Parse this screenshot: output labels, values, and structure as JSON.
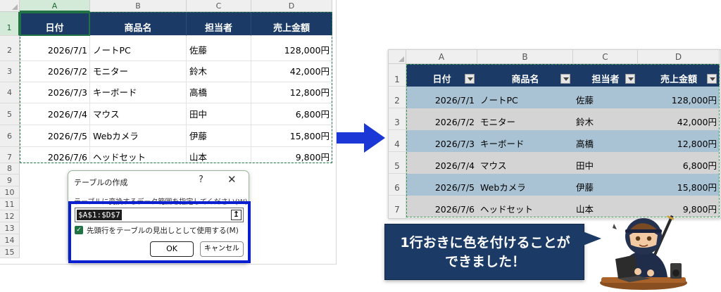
{
  "left_sheet": {
    "columns": [
      "A",
      "B",
      "C",
      "D"
    ],
    "rows": [
      "1",
      "2",
      "3",
      "4",
      "5",
      "6",
      "7",
      "8",
      "9",
      "10",
      "11",
      "12",
      "13",
      "14",
      "15"
    ],
    "header": [
      "日付",
      "商品名",
      "担当者",
      "売上金額"
    ],
    "data": [
      [
        "2026/7/1",
        "ノートPC",
        "佐藤",
        "128,000円"
      ],
      [
        "2026/7/2",
        "モニター",
        "鈴木",
        "42,000円"
      ],
      [
        "2026/7/3",
        "キーボード",
        "高橋",
        "12,800円"
      ],
      [
        "2026/7/4",
        "マウス",
        "田中",
        "6,800円"
      ],
      [
        "2026/7/5",
        "Webカメラ",
        "伊藤",
        "15,800円"
      ],
      [
        "2026/7/6",
        "ヘッドセット",
        "山本",
        "9,800円"
      ]
    ]
  },
  "dialog": {
    "title": "テーブルの作成",
    "help": "?",
    "close": "✕",
    "prompt": "テーブルに変換するデータ範囲を指定してください(W)",
    "range_value": "$A$1:$D$7",
    "collapse_icon": "↥",
    "checkbox_checked": true,
    "checkbox_label": "先頭行をテーブルの見出しとして使用する(M)",
    "ok_label": "OK",
    "cancel_label": "キャンセル"
  },
  "right_sheet": {
    "columns": [
      "A",
      "B",
      "C",
      "D"
    ],
    "rows": [
      "1",
      "2",
      "3",
      "4",
      "5",
      "6",
      "7"
    ],
    "header": [
      "日付",
      "商品名",
      "担当者",
      "売上金額"
    ],
    "data": [
      [
        "2026/7/1",
        "ノートPC",
        "佐藤",
        "128,000円"
      ],
      [
        "2026/7/2",
        "モニター",
        "鈴木",
        "42,000円"
      ],
      [
        "2026/7/3",
        "キーボード",
        "高橋",
        "12,800円"
      ],
      [
        "2026/7/4",
        "マウス",
        "田中",
        "6,800円"
      ],
      [
        "2026/7/5",
        "Webカメラ",
        "伊藤",
        "15,800円"
      ],
      [
        "2026/7/6",
        "ヘッドセット",
        "山本",
        "9,800円"
      ]
    ],
    "band_colors": [
      "#a9c3d4",
      "#d4d4d4"
    ]
  },
  "callout": {
    "text": "1行おきに色を付けることが\nできました！"
  },
  "colors": {
    "header_navy": "#1b3b66",
    "excel_green": "#217346",
    "highlight_blue": "#0a1fd0",
    "arrow_blue": "#1b37d6"
  }
}
